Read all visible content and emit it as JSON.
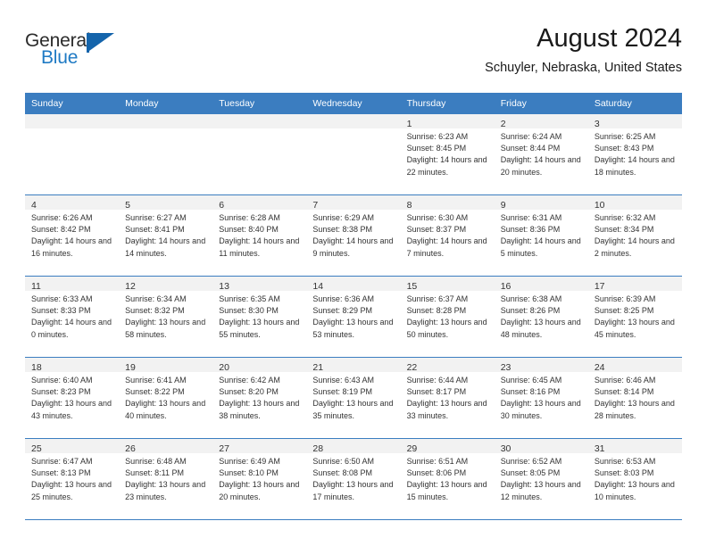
{
  "brand": {
    "name_part1": "General",
    "name_part2": "Blue",
    "accent_color": "#1f7ac4",
    "flag_color": "#1464ab"
  },
  "header": {
    "title": "August 2024",
    "subtitle": "Schuyler, Nebraska, United States"
  },
  "calendar": {
    "header_color": "#3b7dc0",
    "weekdays": [
      "Sunday",
      "Monday",
      "Tuesday",
      "Wednesday",
      "Thursday",
      "Friday",
      "Saturday"
    ],
    "weeks": [
      [
        {
          "day": "",
          "sunrise": "",
          "sunset": "",
          "daylight": ""
        },
        {
          "day": "",
          "sunrise": "",
          "sunset": "",
          "daylight": ""
        },
        {
          "day": "",
          "sunrise": "",
          "sunset": "",
          "daylight": ""
        },
        {
          "day": "",
          "sunrise": "",
          "sunset": "",
          "daylight": ""
        },
        {
          "day": "1",
          "sunrise": "Sunrise: 6:23 AM",
          "sunset": "Sunset: 8:45 PM",
          "daylight": "Daylight: 14 hours and 22 minutes."
        },
        {
          "day": "2",
          "sunrise": "Sunrise: 6:24 AM",
          "sunset": "Sunset: 8:44 PM",
          "daylight": "Daylight: 14 hours and 20 minutes."
        },
        {
          "day": "3",
          "sunrise": "Sunrise: 6:25 AM",
          "sunset": "Sunset: 8:43 PM",
          "daylight": "Daylight: 14 hours and 18 minutes."
        }
      ],
      [
        {
          "day": "4",
          "sunrise": "Sunrise: 6:26 AM",
          "sunset": "Sunset: 8:42 PM",
          "daylight": "Daylight: 14 hours and 16 minutes."
        },
        {
          "day": "5",
          "sunrise": "Sunrise: 6:27 AM",
          "sunset": "Sunset: 8:41 PM",
          "daylight": "Daylight: 14 hours and 14 minutes."
        },
        {
          "day": "6",
          "sunrise": "Sunrise: 6:28 AM",
          "sunset": "Sunset: 8:40 PM",
          "daylight": "Daylight: 14 hours and 11 minutes."
        },
        {
          "day": "7",
          "sunrise": "Sunrise: 6:29 AM",
          "sunset": "Sunset: 8:38 PM",
          "daylight": "Daylight: 14 hours and 9 minutes."
        },
        {
          "day": "8",
          "sunrise": "Sunrise: 6:30 AM",
          "sunset": "Sunset: 8:37 PM",
          "daylight": "Daylight: 14 hours and 7 minutes."
        },
        {
          "day": "9",
          "sunrise": "Sunrise: 6:31 AM",
          "sunset": "Sunset: 8:36 PM",
          "daylight": "Daylight: 14 hours and 5 minutes."
        },
        {
          "day": "10",
          "sunrise": "Sunrise: 6:32 AM",
          "sunset": "Sunset: 8:34 PM",
          "daylight": "Daylight: 14 hours and 2 minutes."
        }
      ],
      [
        {
          "day": "11",
          "sunrise": "Sunrise: 6:33 AM",
          "sunset": "Sunset: 8:33 PM",
          "daylight": "Daylight: 14 hours and 0 minutes."
        },
        {
          "day": "12",
          "sunrise": "Sunrise: 6:34 AM",
          "sunset": "Sunset: 8:32 PM",
          "daylight": "Daylight: 13 hours and 58 minutes."
        },
        {
          "day": "13",
          "sunrise": "Sunrise: 6:35 AM",
          "sunset": "Sunset: 8:30 PM",
          "daylight": "Daylight: 13 hours and 55 minutes."
        },
        {
          "day": "14",
          "sunrise": "Sunrise: 6:36 AM",
          "sunset": "Sunset: 8:29 PM",
          "daylight": "Daylight: 13 hours and 53 minutes."
        },
        {
          "day": "15",
          "sunrise": "Sunrise: 6:37 AM",
          "sunset": "Sunset: 8:28 PM",
          "daylight": "Daylight: 13 hours and 50 minutes."
        },
        {
          "day": "16",
          "sunrise": "Sunrise: 6:38 AM",
          "sunset": "Sunset: 8:26 PM",
          "daylight": "Daylight: 13 hours and 48 minutes."
        },
        {
          "day": "17",
          "sunrise": "Sunrise: 6:39 AM",
          "sunset": "Sunset: 8:25 PM",
          "daylight": "Daylight: 13 hours and 45 minutes."
        }
      ],
      [
        {
          "day": "18",
          "sunrise": "Sunrise: 6:40 AM",
          "sunset": "Sunset: 8:23 PM",
          "daylight": "Daylight: 13 hours and 43 minutes."
        },
        {
          "day": "19",
          "sunrise": "Sunrise: 6:41 AM",
          "sunset": "Sunset: 8:22 PM",
          "daylight": "Daylight: 13 hours and 40 minutes."
        },
        {
          "day": "20",
          "sunrise": "Sunrise: 6:42 AM",
          "sunset": "Sunset: 8:20 PM",
          "daylight": "Daylight: 13 hours and 38 minutes."
        },
        {
          "day": "21",
          "sunrise": "Sunrise: 6:43 AM",
          "sunset": "Sunset: 8:19 PM",
          "daylight": "Daylight: 13 hours and 35 minutes."
        },
        {
          "day": "22",
          "sunrise": "Sunrise: 6:44 AM",
          "sunset": "Sunset: 8:17 PM",
          "daylight": "Daylight: 13 hours and 33 minutes."
        },
        {
          "day": "23",
          "sunrise": "Sunrise: 6:45 AM",
          "sunset": "Sunset: 8:16 PM",
          "daylight": "Daylight: 13 hours and 30 minutes."
        },
        {
          "day": "24",
          "sunrise": "Sunrise: 6:46 AM",
          "sunset": "Sunset: 8:14 PM",
          "daylight": "Daylight: 13 hours and 28 minutes."
        }
      ],
      [
        {
          "day": "25",
          "sunrise": "Sunrise: 6:47 AM",
          "sunset": "Sunset: 8:13 PM",
          "daylight": "Daylight: 13 hours and 25 minutes."
        },
        {
          "day": "26",
          "sunrise": "Sunrise: 6:48 AM",
          "sunset": "Sunset: 8:11 PM",
          "daylight": "Daylight: 13 hours and 23 minutes."
        },
        {
          "day": "27",
          "sunrise": "Sunrise: 6:49 AM",
          "sunset": "Sunset: 8:10 PM",
          "daylight": "Daylight: 13 hours and 20 minutes."
        },
        {
          "day": "28",
          "sunrise": "Sunrise: 6:50 AM",
          "sunset": "Sunset: 8:08 PM",
          "daylight": "Daylight: 13 hours and 17 minutes."
        },
        {
          "day": "29",
          "sunrise": "Sunrise: 6:51 AM",
          "sunset": "Sunset: 8:06 PM",
          "daylight": "Daylight: 13 hours and 15 minutes."
        },
        {
          "day": "30",
          "sunrise": "Sunrise: 6:52 AM",
          "sunset": "Sunset: 8:05 PM",
          "daylight": "Daylight: 13 hours and 12 minutes."
        },
        {
          "day": "31",
          "sunrise": "Sunrise: 6:53 AM",
          "sunset": "Sunset: 8:03 PM",
          "daylight": "Daylight: 13 hours and 10 minutes."
        }
      ]
    ]
  }
}
